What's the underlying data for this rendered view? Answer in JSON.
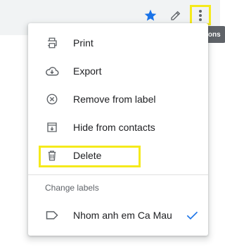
{
  "toolbar": {
    "tooltip_text": "More actions",
    "icons": [
      "star-icon",
      "pencil-icon",
      "more-vert-icon"
    ],
    "star_color": "#1a73e8",
    "highlight_color": "#f5ea1b"
  },
  "menu": {
    "items": [
      {
        "label": "Print",
        "icon": "print-icon"
      },
      {
        "label": "Export",
        "icon": "export-icon"
      },
      {
        "label": "Remove from label",
        "icon": "remove-circle-icon"
      },
      {
        "label": "Hide from contacts",
        "icon": "hide-icon"
      },
      {
        "label": "Delete",
        "icon": "trash-icon"
      }
    ],
    "section_label": "Change labels",
    "labels": [
      {
        "label": "Nhom anh em Ca Mau",
        "icon": "label-icon",
        "checked": true
      }
    ]
  }
}
